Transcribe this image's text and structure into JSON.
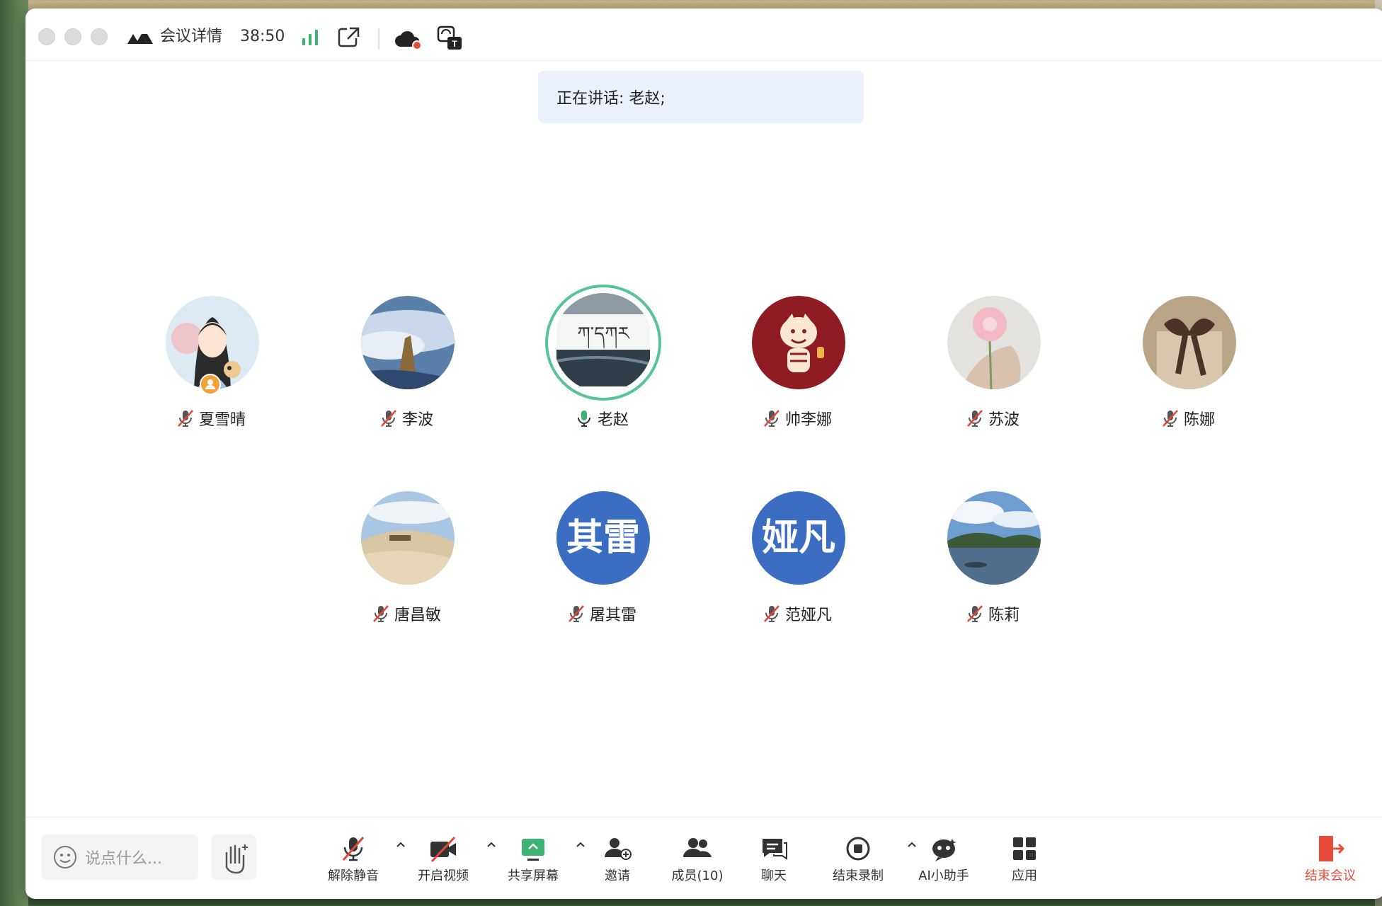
{
  "titlebar": {
    "title": "会议详情",
    "timer": "38:50"
  },
  "speaker": {
    "text": "正在讲话: 老赵;"
  },
  "participants": [
    {
      "name": "夏雪晴",
      "avatar_style": "illustration",
      "muted": true,
      "host": true
    },
    {
      "name": "李波",
      "avatar_style": "photo-clouds",
      "muted": true
    },
    {
      "name": "老赵",
      "avatar_style": "photo-calligraphy",
      "muted": false,
      "speaking": true
    },
    {
      "name": "帅李娜",
      "avatar_style": "tiger-illustration",
      "muted": true
    },
    {
      "name": "苏波",
      "avatar_style": "photo-flower",
      "muted": true
    },
    {
      "name": "陈娜",
      "avatar_style": "photo-ribbon",
      "muted": true
    },
    {
      "name": "唐昌敏",
      "avatar_style": "photo-desert",
      "muted": true
    },
    {
      "name": "屠其雷",
      "avatar_text": "其雷",
      "muted": true
    },
    {
      "name": "范娅凡",
      "avatar_text": "娅凡",
      "muted": true
    },
    {
      "name": "陈莉",
      "avatar_style": "photo-lake",
      "muted": true
    }
  ],
  "toolbar": {
    "chat_placeholder": "说点什么...",
    "unmute": "解除静音",
    "start_video": "开启视频",
    "share_screen": "共享屏幕",
    "invite": "邀请",
    "members": "成员(10)",
    "chat": "聊天",
    "end_recording": "结束录制",
    "ai_assistant": "AI小助手",
    "apps": "应用",
    "end_meeting": "结束会议"
  },
  "colors": {
    "accent_green": "#56c49a",
    "avatar_blue": "#3b6ec3",
    "danger_red": "#e84b3c",
    "mute_red": "#e2463a",
    "speaker_bg": "#eaf1fc"
  }
}
